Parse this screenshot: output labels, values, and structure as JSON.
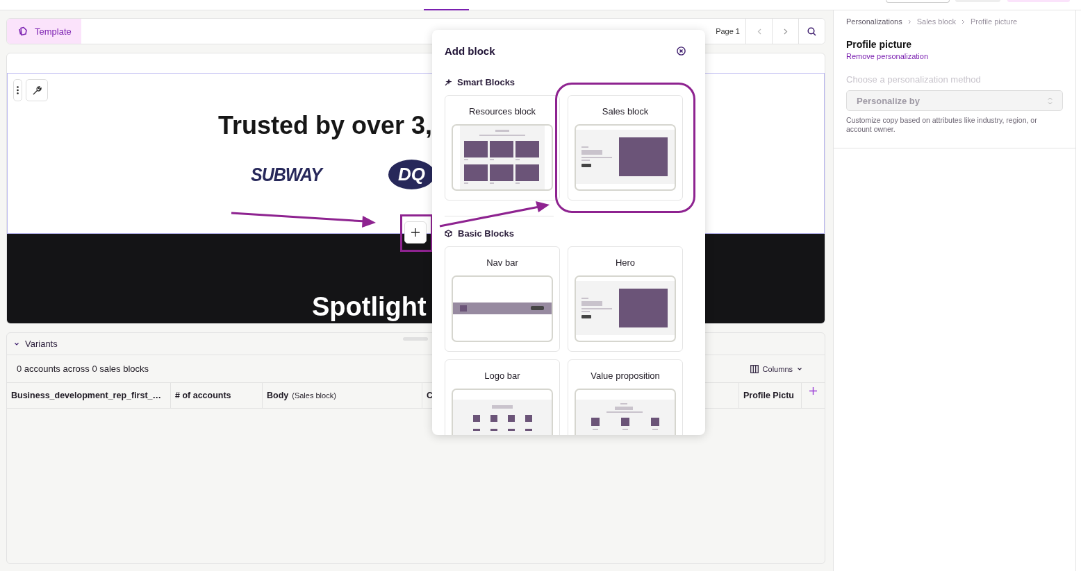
{
  "top_bar": {
    "tab_selected": true
  },
  "toolbar": {
    "tabs": [
      {
        "label": "Template",
        "selected": true
      }
    ],
    "page_label": "Page 1"
  },
  "canvas": {
    "heading": "Trusted by over 3,",
    "logos": [
      {
        "text": "SUBWAY",
        "kind": "wordmark"
      },
      {
        "text": "DQ",
        "kind": "badge"
      }
    ],
    "dark_heading": "Spotlight"
  },
  "add_block": {
    "title": "Add block",
    "sections": [
      {
        "title": "Smart Blocks",
        "kind": "smart",
        "blocks": [
          {
            "label": "Resources block",
            "kind": "grid",
            "highlighted": false
          },
          {
            "label": "Sales block",
            "kind": "hero",
            "highlighted": true
          }
        ]
      },
      {
        "title": "Basic Blocks",
        "kind": "basic",
        "blocks": [
          {
            "label": "Nav bar",
            "kind": "nav",
            "highlighted": false
          },
          {
            "label": "Hero",
            "kind": "hero",
            "highlighted": false
          },
          {
            "label": "Logo bar",
            "kind": "logos",
            "highlighted": false
          },
          {
            "label": "Value proposition",
            "kind": "values",
            "highlighted": false
          }
        ]
      }
    ]
  },
  "variants": {
    "title": "Variants",
    "expanded": true,
    "summary": "0 accounts across 0 sales blocks",
    "columns_button": "Columns",
    "columns": [
      {
        "label": "Business_development_rep_first_…"
      },
      {
        "label": "# of accounts"
      },
      {
        "label": "Body",
        "note": "(Sales block)"
      },
      {
        "label": "C"
      },
      {
        "label": "Profile Pictu"
      }
    ]
  },
  "panel": {
    "breadcrumbs": [
      {
        "label": "Personalizations",
        "kind": "link"
      },
      {
        "label": "Sales block",
        "kind": "text"
      },
      {
        "label": "Profile picture",
        "kind": "text"
      }
    ],
    "title": "Profile picture",
    "link": "Remove personalization",
    "method_label": "Choose a personalization method",
    "select": {
      "placeholder": "Personalize by",
      "disabled": true
    },
    "help": "Customize copy based on attributes like industry, region, or account owner."
  }
}
